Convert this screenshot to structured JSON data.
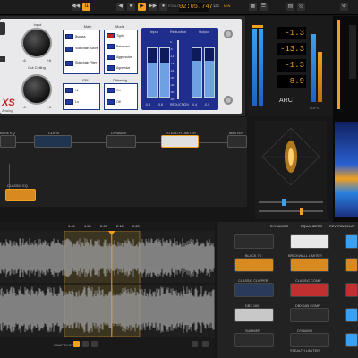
{
  "transport": {
    "time": "02:05.747",
    "tempo": "120",
    "units": "MIN",
    "follow_label": "FOLLOW"
  },
  "eq_plugin": {
    "knobs": [
      {
        "label": "Input",
        "min": "-6",
        "max": "+6"
      },
      {
        "label": "Out Ceiling",
        "min": "-6",
        "max": "+6"
      }
    ],
    "brand": "XS",
    "brand_sub": "Analog",
    "main_group": {
      "title": "Main",
      "items": [
        "Bypass",
        "Sidechain Active",
        "Sidechain Filter"
      ]
    },
    "mode_group": {
      "title": "Mode",
      "items": [
        "Tight",
        "Balanced",
        "Aggressive",
        "Agressive"
      ]
    },
    "epl_group": {
      "title": "EPL",
      "items": [
        "Hi",
        "Lo"
      ]
    },
    "dithering_group": {
      "title": "Dithering",
      "items": [
        "On",
        "Off"
      ]
    },
    "meter_panel": {
      "headers": [
        "Input",
        "Reduction",
        "Output"
      ],
      "scale": [
        "0",
        "-6",
        "-12",
        "-18",
        "-24",
        "-30",
        "-40",
        "-50",
        "-60"
      ],
      "footer": [
        "-0.8",
        "-0.8",
        "REDUCTION",
        "-0.4",
        "-0.9"
      ]
    }
  },
  "meters": {
    "readouts": [
      "-1.3",
      "-13.3",
      "-1.3",
      "8.9"
    ],
    "caption": "ARC",
    "lufs_label": "LUFS"
  },
  "chain": {
    "nodes": [
      {
        "name": "BASE EQ"
      },
      {
        "name": "CLIP B"
      },
      {
        "name": "DYNAMIX"
      },
      {
        "name": "STEALTH LIMITER"
      },
      {
        "name": "MASTER"
      },
      {
        "name": "CLASSIC EQ"
      }
    ]
  },
  "waveform": {
    "ruler": [
      "1:40",
      "1:50",
      "2:00",
      "2:10",
      "2:20"
    ],
    "region_start": 0.3,
    "region_end": 0.65,
    "playhead": 0.52,
    "bottom_label": "SNAPSHOT"
  },
  "browser": {
    "tabs": [
      "DYNAMICS",
      "EQUALIZERS",
      "REVERB/DELAY"
    ],
    "modules": [
      {
        "name": "BLACK 76"
      },
      {
        "name": "BRICKWALL LIMITER"
      },
      {
        "name": "CLASSIC CLIPPER"
      },
      {
        "name": "CLASSIC COMP"
      },
      {
        "name": "DBX 160"
      },
      {
        "name": "DBX 165 COMP"
      },
      {
        "name": "DYNAMIX"
      },
      {
        "name": "SUMMER"
      },
      {
        "name": "STEALTH LIMITER"
      }
    ]
  },
  "colors": {
    "accent": "#f0a020",
    "panel": "#1f2e8c",
    "meter": "#3ba0f0"
  }
}
